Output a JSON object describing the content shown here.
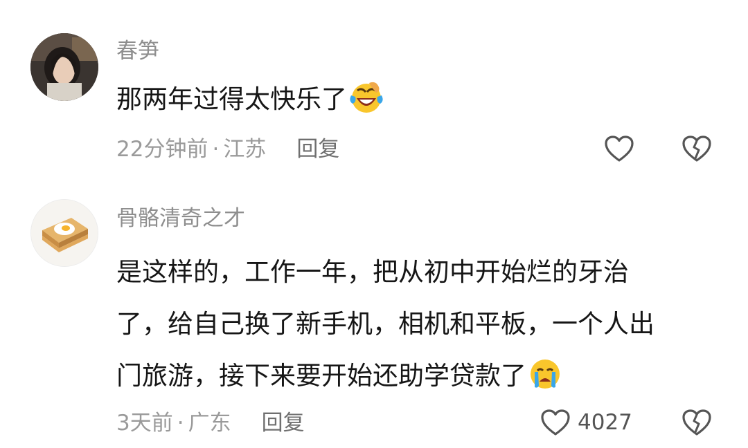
{
  "comments": [
    {
      "username": "春笋",
      "text": "那两年过得太快乐了",
      "emoji": "laughing-crying-emoji",
      "time": "22分钟前",
      "location": "江苏",
      "reply_label": "回复",
      "like_count": ""
    },
    {
      "username": "骨骼清奇之才",
      "text_lines": [
        "是这样的，工作一年，把从初中开始烂的牙治",
        "了，给自己换了新手机，相机和平板，一个人出",
        "门旅游，接下来要开始还助学贷款了"
      ],
      "emoji": "crying-emoji",
      "time": "3天前",
      "location": "广东",
      "reply_label": "回复",
      "like_count": "4027"
    }
  ],
  "separator": "·",
  "icons": [
    "heart-outline-icon",
    "broken-heart-icon"
  ],
  "colors": {
    "username": "#8e8e8e",
    "meta": "#9a9a9a",
    "text": "#161616",
    "emoji_yellow": "#f9c62c",
    "tear_blue": "#3aa6e8"
  }
}
